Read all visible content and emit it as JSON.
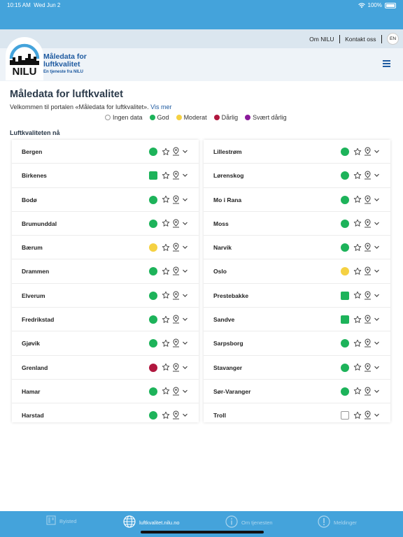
{
  "status_bar": {
    "time": "10:15 AM",
    "date": "Wed Jun 2",
    "battery": "100%"
  },
  "top_links": {
    "about": "Om NILU",
    "contact": "Kontakt oss",
    "lang": "EN"
  },
  "logo": {
    "title": "Måledata for luftkvalitet",
    "title_line1": "Måledata for",
    "title_line2": "luftkvalitet",
    "subtitle": "En tjeneste fra NILU",
    "brand": "NILU"
  },
  "page": {
    "title": "Måledata for luftkvalitet",
    "intro": "Velkommen til portalen «Måledata for luftkvalitet».",
    "more_link": "Vis mer",
    "section_title": "Luftkvaliteten nå"
  },
  "legend": [
    {
      "label": "Ingen data",
      "color": "#ffffff",
      "border": "#999999"
    },
    {
      "label": "God",
      "color": "#1db35a"
    },
    {
      "label": "Moderat",
      "color": "#f5d142"
    },
    {
      "label": "Dårlig",
      "color": "#b0173e"
    },
    {
      "label": "Svært dårlig",
      "color": "#8a1a9a"
    }
  ],
  "colors": {
    "good": "#1db35a",
    "moderate": "#f5d142",
    "bad": "#b0173e",
    "none": "#ffffff",
    "accent": "#44a3db",
    "brand": "#1e5aa0"
  },
  "stations_left": [
    {
      "name": "Bergen",
      "status": "good",
      "shape": "circle"
    },
    {
      "name": "Birkenes",
      "status": "good",
      "shape": "square"
    },
    {
      "name": "Bodø",
      "status": "good",
      "shape": "circle"
    },
    {
      "name": "Brumunddal",
      "status": "good",
      "shape": "circle"
    },
    {
      "name": "Bærum",
      "status": "moderate",
      "shape": "circle"
    },
    {
      "name": "Drammen",
      "status": "good",
      "shape": "circle"
    },
    {
      "name": "Elverum",
      "status": "good",
      "shape": "circle"
    },
    {
      "name": "Fredrikstad",
      "status": "good",
      "shape": "circle"
    },
    {
      "name": "Gjøvik",
      "status": "good",
      "shape": "circle"
    },
    {
      "name": "Grenland",
      "status": "bad",
      "shape": "circle"
    },
    {
      "name": "Hamar",
      "status": "good",
      "shape": "circle"
    },
    {
      "name": "Harstad",
      "status": "good",
      "shape": "circle"
    }
  ],
  "stations_right": [
    {
      "name": "Lillestrøm",
      "status": "good",
      "shape": "circle"
    },
    {
      "name": "Lørenskog",
      "status": "good",
      "shape": "circle"
    },
    {
      "name": "Mo i Rana",
      "status": "good",
      "shape": "circle"
    },
    {
      "name": "Moss",
      "status": "good",
      "shape": "circle"
    },
    {
      "name": "Narvik",
      "status": "good",
      "shape": "circle"
    },
    {
      "name": "Oslo",
      "status": "moderate",
      "shape": "circle"
    },
    {
      "name": "Prestebakke",
      "status": "good",
      "shape": "square"
    },
    {
      "name": "Sandve",
      "status": "good",
      "shape": "square"
    },
    {
      "name": "Sarpsborg",
      "status": "good",
      "shape": "circle"
    },
    {
      "name": "Stavanger",
      "status": "good",
      "shape": "circle"
    },
    {
      "name": "Sør-Varanger",
      "status": "good",
      "shape": "circle"
    },
    {
      "name": "Troll",
      "status": "none",
      "shape": "square"
    }
  ],
  "bottom_tabs": [
    {
      "label": "Byisted",
      "icon": "city-icon",
      "active": false
    },
    {
      "label": "luftkvalitet.nilu.no",
      "icon": "globe-icon",
      "active": true
    },
    {
      "label": "Om tjenesten",
      "icon": "info-icon",
      "active": false
    },
    {
      "label": "Meldinger",
      "icon": "alert-icon",
      "active": false
    }
  ]
}
